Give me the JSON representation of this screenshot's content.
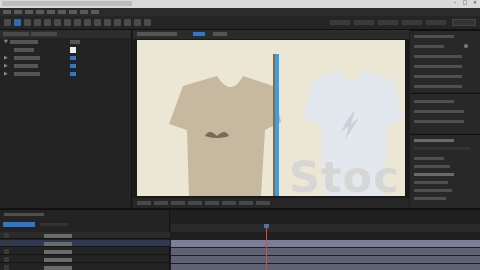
{
  "app": {
    "title": ""
  },
  "menu": {
    "items": []
  },
  "toolbar": {
    "search_placeholder": ""
  },
  "effect_controls": {
    "tab_label": "",
    "properties": []
  },
  "viewer": {
    "tab_label": "",
    "zoom": "",
    "timecode": ""
  },
  "canvas": {
    "watermark": "Stoc"
  },
  "right_panel": {
    "tabs": [],
    "items": []
  },
  "timeline": {
    "timecode": "",
    "layers": []
  },
  "colors": {
    "accent": "#2d79c7",
    "playhead": "#d94a3a",
    "guide": "#3aa0e6"
  }
}
